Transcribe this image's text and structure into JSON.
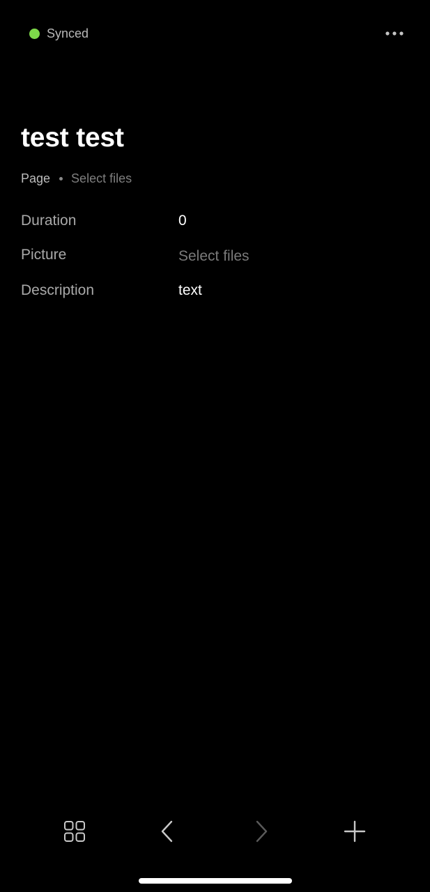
{
  "status": {
    "label": "Synced",
    "color": "#7ed94a",
    "icon": "sync-status-dot"
  },
  "header": {
    "more_icon": "more-horizontal-icon"
  },
  "page": {
    "title": "test test",
    "type_label": "Page",
    "files_link": "Select files"
  },
  "properties": [
    {
      "label": "Duration",
      "value": "0",
      "placeholder": false
    },
    {
      "label": "Picture",
      "value": "Select files",
      "placeholder": true
    },
    {
      "label": "Description",
      "value": "text",
      "placeholder": false
    }
  ],
  "toolbar": {
    "grid_icon": "grid-icon",
    "back_icon": "chevron-left-icon",
    "forward_icon": "chevron-right-icon",
    "add_icon": "plus-icon"
  }
}
